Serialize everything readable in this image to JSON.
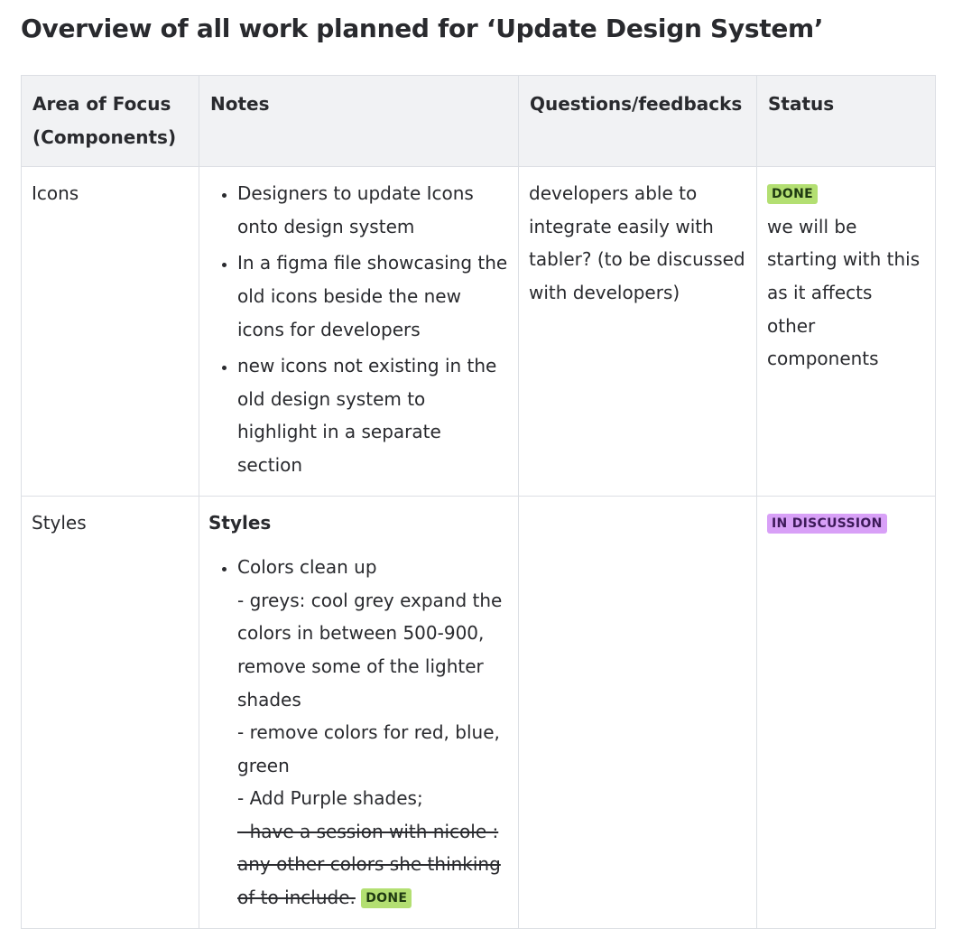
{
  "page": {
    "title": "Overview of all work planned for ‘Update Design System’"
  },
  "table": {
    "headers": {
      "area": "Area of Focus (Components)",
      "notes": "Notes",
      "questions": "Questions/feedbacks",
      "status": "Status"
    },
    "rows": [
      {
        "area": "Icons",
        "notes": [
          "Designers to update Icons onto design system",
          "In a figma file showcasing the old icons beside the new icons for developers",
          "new icons not existing in the old design system to highlight in a separate section"
        ],
        "questions": "developers able to integrate easily with tabler? (to be discussed with developers)",
        "status_badge": "DONE",
        "status_note": "we will be starting with this as it affects other components"
      },
      {
        "area": "Styles",
        "notes_heading": "Styles",
        "notes_item_title": "Colors clean up",
        "notes_item_lines": [
          "- greys: cool grey expand the colors in between 500-900, remove some of the lighter shades",
          "- remove colors for red, blue, green",
          "- Add Purple shades;"
        ],
        "notes_struck": "- have a session with nicole : any other colors she thinking of to include.",
        "notes_struck_badge": "DONE",
        "questions": "",
        "status_badge": "IN DISCUSSION"
      }
    ]
  },
  "colors": {
    "header_bg": "#f1f2f4",
    "border": "#dcdfe4",
    "badge_done": "#b3df72",
    "badge_discussion": "#d8a0f7",
    "text": "#292a2e"
  }
}
